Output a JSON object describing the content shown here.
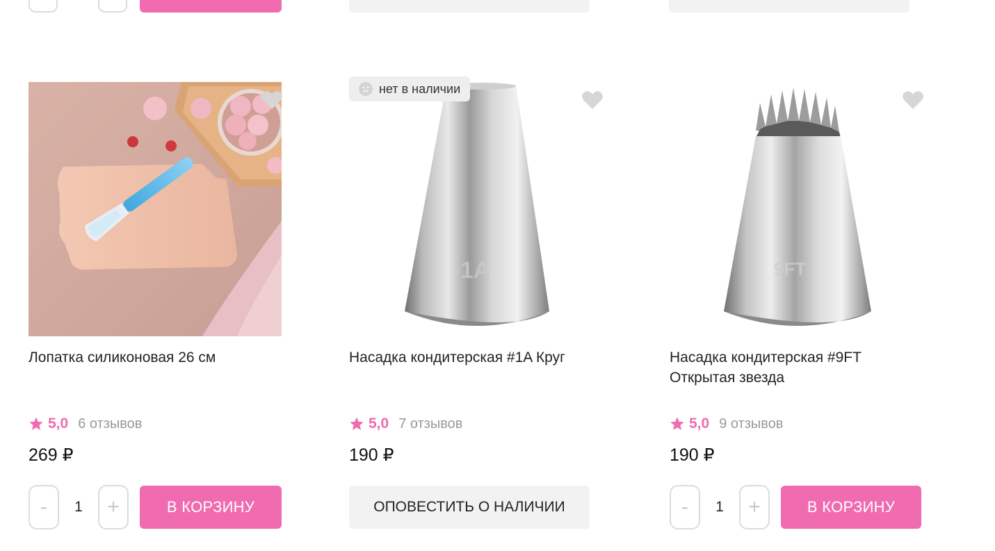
{
  "colors": {
    "accent": "#f06bb0",
    "rating": "#f06bb0",
    "muted": "#999999",
    "button_grey": "#f2f2f2"
  },
  "products": [
    {
      "title": "Лопатка силиконовая 26 см",
      "rating": "5,0",
      "reviews": "6 отзывов",
      "price": "269 ₽",
      "quantity": "1",
      "minus": "-",
      "plus": "+",
      "button": "В КОРЗИНУ",
      "in_stock": true,
      "image_icon": "silicone-spatula-photo"
    },
    {
      "title": "Насадка кондитерская #1A Круг",
      "rating": "5,0",
      "reviews": "7 отзывов",
      "price": "190 ₽",
      "button": "ОПОВЕСТИТЬ О НАЛИЧИИ",
      "in_stock": false,
      "badge": "нет в наличии",
      "tip_mark": "1A",
      "image_icon": "round-piping-tip-photo"
    },
    {
      "title": "Насадка кондитерская #9FT Открытая звезда",
      "rating": "5,0",
      "reviews": "9 отзывов",
      "price": "190 ₽",
      "quantity": "1",
      "minus": "-",
      "plus": "+",
      "button": "В КОРЗИНУ",
      "in_stock": true,
      "tip_mark": "9FT",
      "image_icon": "star-piping-tip-photo"
    }
  ]
}
